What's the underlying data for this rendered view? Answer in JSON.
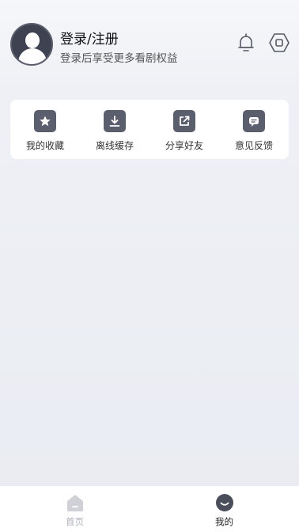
{
  "profile": {
    "login_title": "登录/注册",
    "login_subtitle": "登录后享受更多看剧权益"
  },
  "header_icons": [
    "bell-icon",
    "settings-icon"
  ],
  "quick_actions": [
    {
      "label": "我的收藏",
      "icon": "star-icon"
    },
    {
      "label": "离线缓存",
      "icon": "download-icon"
    },
    {
      "label": "分享好友",
      "icon": "share-icon"
    },
    {
      "label": "意见反馈",
      "icon": "feedback-icon"
    }
  ],
  "tabbar": [
    {
      "label": "首页",
      "icon": "home-icon",
      "active": false
    },
    {
      "label": "我的",
      "icon": "mine-icon",
      "active": true
    }
  ],
  "colors": {
    "icon_bg": "#5b5f6d",
    "inactive_tab": "#b0b3ba",
    "active_tab": "#222222"
  }
}
